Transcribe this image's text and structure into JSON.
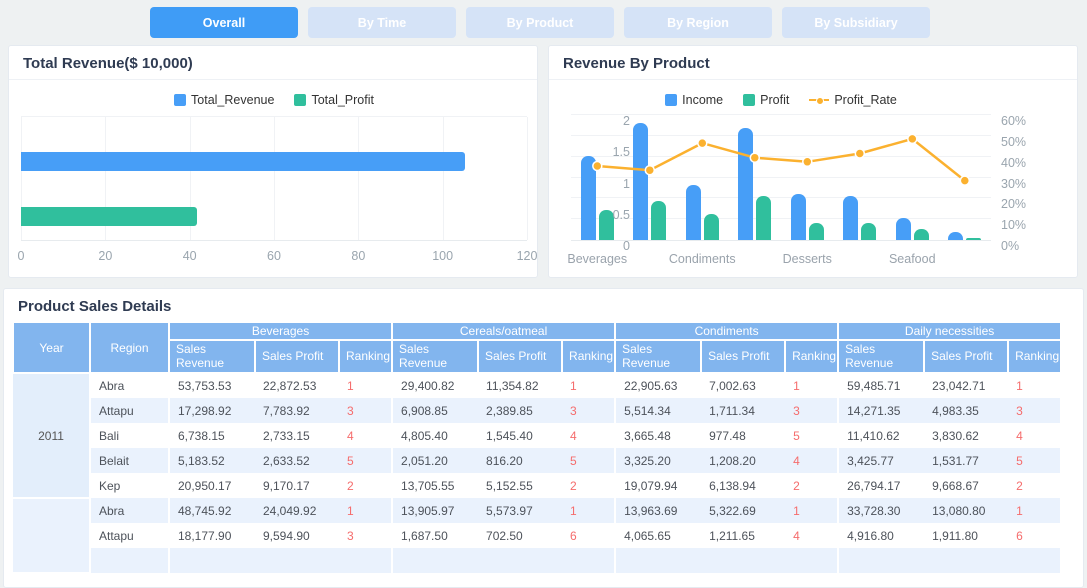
{
  "tabs": {
    "items": [
      {
        "label": "Overall",
        "active": true
      },
      {
        "label": "By Time",
        "active": false
      },
      {
        "label": "By Product",
        "active": false
      },
      {
        "label": "By Region",
        "active": false
      },
      {
        "label": "By Subsidiary",
        "active": false
      }
    ]
  },
  "colors": {
    "accent_blue": "#3f9cf6",
    "tab_inactive": "#d5e3f7",
    "bar_blue": "#479ef7",
    "bar_green": "#30bf9d",
    "line_orange": "#fbb12f",
    "table_header_blue": "#82b5ee",
    "row_alt_blue": "#eaf2fd",
    "ranking_red": "#f56c6c"
  },
  "chart_data": [
    {
      "type": "bar",
      "orientation": "horizontal",
      "title": "Total Revenue($ 10,000)",
      "legend": [
        "Total_Revenue",
        "Total_Profit"
      ],
      "series": [
        {
          "name": "Total_Revenue",
          "value": 105.4,
          "color": "#479ef7"
        },
        {
          "name": "Total_Profit",
          "value": 41.8,
          "color": "#30bf9d"
        }
      ],
      "xlim": [
        0,
        120
      ],
      "xticks": [
        0,
        20,
        40,
        60,
        80,
        100,
        120
      ],
      "grid": true,
      "legend_position": "top"
    },
    {
      "type": "bar",
      "subtype": "bar+line",
      "title": "Revenue By Product",
      "legend": [
        "Income",
        "Profit",
        "Profit_Rate"
      ],
      "categories": [
        "Beverages",
        "",
        "Condiments",
        "",
        "Desserts",
        "",
        "Seafood",
        ""
      ],
      "series": [
        {
          "name": "Income",
          "kind": "bar",
          "color": "#479ef7",
          "values": [
            1.35,
            1.87,
            0.88,
            1.79,
            0.73,
            0.71,
            0.35,
            0.13
          ]
        },
        {
          "name": "Profit",
          "kind": "bar",
          "color": "#30bf9d",
          "values": [
            0.48,
            0.62,
            0.41,
            0.71,
            0.27,
            0.28,
            0.17,
            0.03
          ]
        },
        {
          "name": "Profit_Rate",
          "kind": "line",
          "axis": "right",
          "color": "#fbb12f",
          "values": [
            36,
            34,
            47,
            40,
            38,
            42,
            49,
            29
          ]
        }
      ],
      "y_left": {
        "lim": [
          0,
          2
        ],
        "ticks": [
          "0",
          "0.5",
          "1",
          "1.5",
          "2"
        ]
      },
      "y_right": {
        "lim": [
          0,
          60
        ],
        "ticks": [
          "0%",
          "10%",
          "20%",
          "30%",
          "40%",
          "50%",
          "60%"
        ]
      },
      "grid": true,
      "legend_position": "top"
    }
  ],
  "table": {
    "title": "Product Sales Details",
    "year_header": "Year",
    "region_header": "Region",
    "groups": [
      "Beverages",
      "Cereals/oatmeal",
      "Condiments",
      "Daily necessities"
    ],
    "sub_headers": [
      "Sales Revenue",
      "Sales Profit",
      "Ranking"
    ],
    "year_groups": [
      {
        "label": "2011",
        "rows": [
          {
            "region": "Abra",
            "cells": [
              [
                "53,753.53",
                "22,872.53",
                "1"
              ],
              [
                "29,400.82",
                "11,354.82",
                "1"
              ],
              [
                "22,905.63",
                "7,002.63",
                "1"
              ],
              [
                "59,485.71",
                "23,042.71",
                "1"
              ]
            ]
          },
          {
            "region": "Attapu",
            "cells": [
              [
                "17,298.92",
                "7,783.92",
                "3"
              ],
              [
                "6,908.85",
                "2,389.85",
                "3"
              ],
              [
                "5,514.34",
                "1,711.34",
                "3"
              ],
              [
                "14,271.35",
                "4,983.35",
                "3"
              ]
            ]
          },
          {
            "region": "Bali",
            "cells": [
              [
                "6,738.15",
                "2,733.15",
                "4"
              ],
              [
                "4,805.40",
                "1,545.40",
                "4"
              ],
              [
                "3,665.48",
                "977.48",
                "5"
              ],
              [
                "11,410.62",
                "3,830.62",
                "4"
              ]
            ]
          },
          {
            "region": "Belait",
            "cells": [
              [
                "5,183.52",
                "2,633.52",
                "5"
              ],
              [
                "2,051.20",
                "816.20",
                "5"
              ],
              [
                "3,325.20",
                "1,208.20",
                "4"
              ],
              [
                "3,425.77",
                "1,531.77",
                "5"
              ]
            ]
          },
          {
            "region": "Kep",
            "cells": [
              [
                "20,950.17",
                "9,170.17",
                "2"
              ],
              [
                "13,705.55",
                "5,152.55",
                "2"
              ],
              [
                "19,079.94",
                "6,138.94",
                "2"
              ],
              [
                "26,794.17",
                "9,668.67",
                "2"
              ]
            ]
          }
        ]
      },
      {
        "label": "",
        "rows": [
          {
            "region": "Abra",
            "cells": [
              [
                "48,745.92",
                "24,049.92",
                "1"
              ],
              [
                "13,905.97",
                "5,573.97",
                "1"
              ],
              [
                "13,963.69",
                "5,322.69",
                "1"
              ],
              [
                "33,728.30",
                "13,080.80",
                "1"
              ]
            ]
          },
          {
            "region": "Attapu",
            "cells": [
              [
                "18,177.90",
                "9,594.90",
                "3"
              ],
              [
                "1,687.50",
                "702.50",
                "6"
              ],
              [
                "4,065.65",
                "1,211.65",
                "4"
              ],
              [
                "4,916.80",
                "1,911.80",
                "6"
              ]
            ]
          },
          {
            "region": "",
            "cells": [
              [
                "",
                "",
                ""
              ],
              [
                "",
                "",
                ""
              ],
              [
                "",
                "",
                ""
              ],
              [
                "",
                "",
                ""
              ]
            ]
          }
        ]
      }
    ]
  }
}
